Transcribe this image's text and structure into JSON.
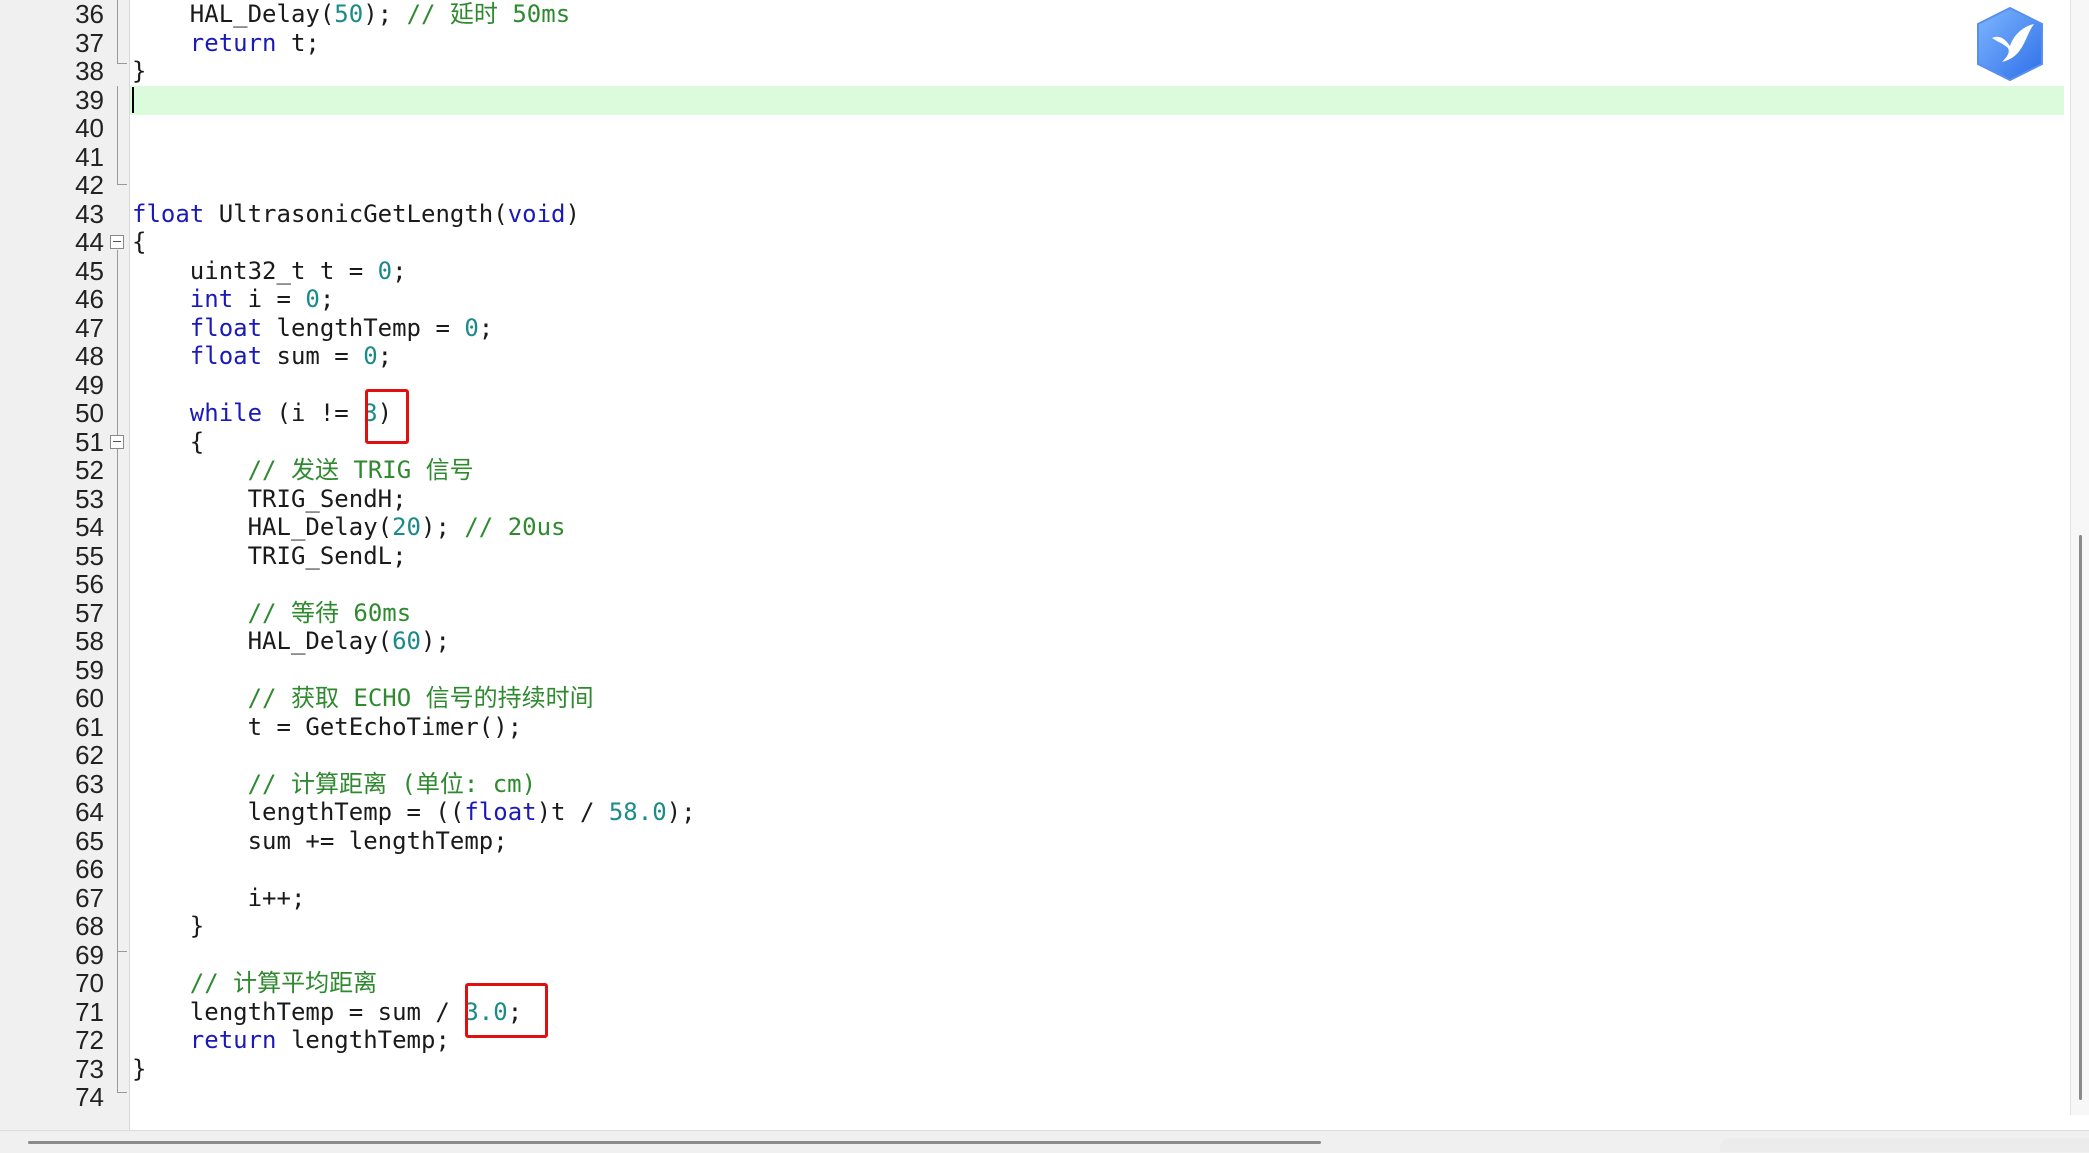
{
  "app_logo": "bird-logo-icon",
  "editor": {
    "lines": [
      {
        "n": "36",
        "tokens": [
          {
            "t": "    HAL_Delay(",
            "c": ""
          },
          {
            "t": "50",
            "c": "num"
          },
          {
            "t": "); ",
            "c": ""
          },
          {
            "t": "// 延时 50ms",
            "c": "cm"
          }
        ]
      },
      {
        "n": "37",
        "tokens": [
          {
            "t": "    ",
            "c": ""
          },
          {
            "t": "return",
            "c": "kw"
          },
          {
            "t": " t;",
            "c": ""
          }
        ]
      },
      {
        "n": "38",
        "tokens": [
          {
            "t": "}",
            "c": ""
          }
        ]
      },
      {
        "n": "39",
        "tokens": []
      },
      {
        "n": "40",
        "tokens": []
      },
      {
        "n": "41",
        "tokens": []
      },
      {
        "n": "42",
        "tokens": []
      },
      {
        "n": "43",
        "tokens": [
          {
            "t": "float",
            "c": "kw"
          },
          {
            "t": " UltrasonicGetLength(",
            "c": ""
          },
          {
            "t": "void",
            "c": "kw"
          },
          {
            "t": ")",
            "c": ""
          }
        ]
      },
      {
        "n": "44",
        "tokens": [
          {
            "t": "{",
            "c": ""
          }
        ]
      },
      {
        "n": "45",
        "tokens": [
          {
            "t": "    uint32_t t = ",
            "c": ""
          },
          {
            "t": "0",
            "c": "num"
          },
          {
            "t": ";",
            "c": ""
          }
        ]
      },
      {
        "n": "46",
        "tokens": [
          {
            "t": "    ",
            "c": ""
          },
          {
            "t": "int",
            "c": "kw"
          },
          {
            "t": " i = ",
            "c": ""
          },
          {
            "t": "0",
            "c": "num"
          },
          {
            "t": ";",
            "c": ""
          }
        ]
      },
      {
        "n": "47",
        "tokens": [
          {
            "t": "    ",
            "c": ""
          },
          {
            "t": "float",
            "c": "kw"
          },
          {
            "t": " lengthTemp = ",
            "c": ""
          },
          {
            "t": "0",
            "c": "num"
          },
          {
            "t": ";",
            "c": ""
          }
        ]
      },
      {
        "n": "48",
        "tokens": [
          {
            "t": "    ",
            "c": ""
          },
          {
            "t": "float",
            "c": "kw"
          },
          {
            "t": " sum = ",
            "c": ""
          },
          {
            "t": "0",
            "c": "num"
          },
          {
            "t": ";",
            "c": ""
          }
        ]
      },
      {
        "n": "49",
        "tokens": []
      },
      {
        "n": "50",
        "tokens": [
          {
            "t": "    ",
            "c": ""
          },
          {
            "t": "while",
            "c": "kw"
          },
          {
            "t": " (i != ",
            "c": ""
          },
          {
            "t": "3",
            "c": "num"
          },
          {
            "t": ")",
            "c": ""
          }
        ]
      },
      {
        "n": "51",
        "tokens": [
          {
            "t": "    {",
            "c": ""
          }
        ]
      },
      {
        "n": "52",
        "tokens": [
          {
            "t": "        ",
            "c": ""
          },
          {
            "t": "// 发送 TRIG 信号",
            "c": "cm"
          }
        ]
      },
      {
        "n": "53",
        "tokens": [
          {
            "t": "        TRIG_SendH;",
            "c": ""
          }
        ]
      },
      {
        "n": "54",
        "tokens": [
          {
            "t": "        HAL_Delay(",
            "c": ""
          },
          {
            "t": "20",
            "c": "num"
          },
          {
            "t": "); ",
            "c": ""
          },
          {
            "t": "// 20us",
            "c": "cm"
          }
        ]
      },
      {
        "n": "55",
        "tokens": [
          {
            "t": "        TRIG_SendL;",
            "c": ""
          }
        ]
      },
      {
        "n": "56",
        "tokens": []
      },
      {
        "n": "57",
        "tokens": [
          {
            "t": "        ",
            "c": ""
          },
          {
            "t": "// 等待 60ms",
            "c": "cm"
          }
        ]
      },
      {
        "n": "58",
        "tokens": [
          {
            "t": "        HAL_Delay(",
            "c": ""
          },
          {
            "t": "60",
            "c": "num"
          },
          {
            "t": ");",
            "c": ""
          }
        ]
      },
      {
        "n": "59",
        "tokens": []
      },
      {
        "n": "60",
        "tokens": [
          {
            "t": "        ",
            "c": ""
          },
          {
            "t": "// 获取 ECHO 信号的持续时间",
            "c": "cm"
          }
        ]
      },
      {
        "n": "61",
        "tokens": [
          {
            "t": "        t = GetEchoTimer();",
            "c": ""
          }
        ]
      },
      {
        "n": "62",
        "tokens": []
      },
      {
        "n": "63",
        "tokens": [
          {
            "t": "        ",
            "c": ""
          },
          {
            "t": "// 计算距离 (单位: cm)",
            "c": "cm"
          }
        ]
      },
      {
        "n": "64",
        "tokens": [
          {
            "t": "        lengthTemp = ((",
            "c": ""
          },
          {
            "t": "float",
            "c": "kw"
          },
          {
            "t": ")t / ",
            "c": ""
          },
          {
            "t": "58.0",
            "c": "num"
          },
          {
            "t": ");",
            "c": ""
          }
        ]
      },
      {
        "n": "65",
        "tokens": [
          {
            "t": "        sum += lengthTemp;",
            "c": ""
          }
        ]
      },
      {
        "n": "66",
        "tokens": []
      },
      {
        "n": "67",
        "tokens": [
          {
            "t": "        i++;",
            "c": ""
          }
        ]
      },
      {
        "n": "68",
        "tokens": [
          {
            "t": "    }",
            "c": ""
          }
        ]
      },
      {
        "n": "69",
        "tokens": []
      },
      {
        "n": "70",
        "tokens": [
          {
            "t": "    ",
            "c": ""
          },
          {
            "t": "// 计算平均距离",
            "c": "cm"
          }
        ]
      },
      {
        "n": "71",
        "tokens": [
          {
            "t": "    lengthTemp = sum / ",
            "c": ""
          },
          {
            "t": "3.0",
            "c": "num"
          },
          {
            "t": ";",
            "c": ""
          }
        ]
      },
      {
        "n": "72",
        "tokens": [
          {
            "t": "    ",
            "c": ""
          },
          {
            "t": "return",
            "c": "kw"
          },
          {
            "t": " lengthTemp;",
            "c": ""
          }
        ]
      },
      {
        "n": "73",
        "tokens": [
          {
            "t": "}",
            "c": ""
          }
        ]
      },
      {
        "n": "74",
        "tokens": []
      }
    ],
    "current_line": "39",
    "annotations": [
      "3",
      "3.0;"
    ]
  }
}
